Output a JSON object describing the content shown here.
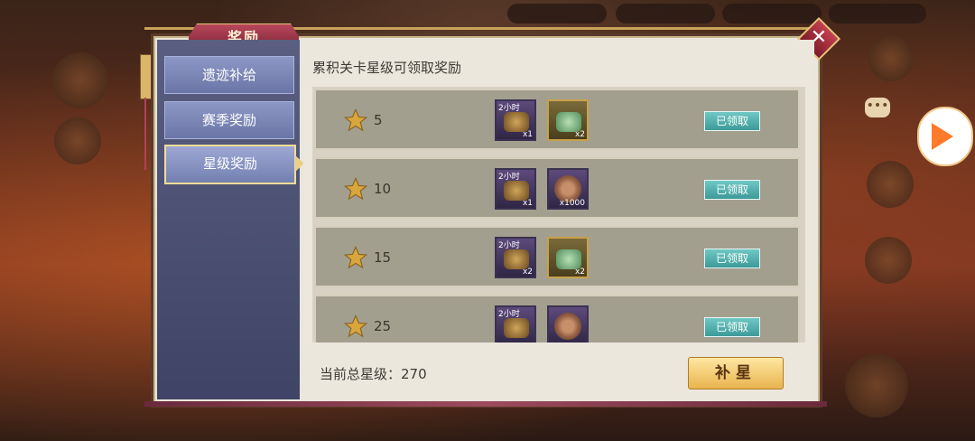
{
  "dialog": {
    "title": "奖励",
    "close_glyph": "✕"
  },
  "tabs": [
    {
      "label": "遗迹补给",
      "active": false
    },
    {
      "label": "赛季奖励",
      "active": false
    },
    {
      "label": "星级奖励",
      "active": true
    }
  ],
  "main": {
    "heading": "累积关卡星级可领取奖励",
    "rows": [
      {
        "stars": "5",
        "items": [
          {
            "tag": "2小时",
            "qty": "x1",
            "kind": "money",
            "frame": "purple"
          },
          {
            "tag": "",
            "qty": "x2",
            "kind": "jade",
            "frame": "gold"
          }
        ],
        "button": "已领取"
      },
      {
        "stars": "10",
        "items": [
          {
            "tag": "2小时",
            "qty": "x1",
            "kind": "money",
            "frame": "purple"
          },
          {
            "tag": "",
            "qty": "x1000",
            "kind": "coin",
            "frame": "purple"
          }
        ],
        "button": "已领取"
      },
      {
        "stars": "15",
        "items": [
          {
            "tag": "2小时",
            "qty": "x2",
            "kind": "money",
            "frame": "purple"
          },
          {
            "tag": "",
            "qty": "x2",
            "kind": "jade",
            "frame": "gold"
          }
        ],
        "button": "已领取"
      },
      {
        "stars": "25",
        "items": [
          {
            "tag": "2小时",
            "qty": "",
            "kind": "money",
            "frame": "purple"
          },
          {
            "tag": "",
            "qty": "",
            "kind": "coin",
            "frame": "purple"
          }
        ],
        "button": "已领取"
      }
    ],
    "footer_label": "当前总星级：270",
    "supplement_button": "补星"
  },
  "colors": {
    "accent": "#e8b44e",
    "claim": "#3c9a98",
    "star": "#d8a63c"
  },
  "icons": {
    "star": "star-icon",
    "close": "close-icon",
    "video": "play-icon",
    "chat": "chat-icon"
  },
  "overlay": {
    "chat_dots": "•••"
  }
}
